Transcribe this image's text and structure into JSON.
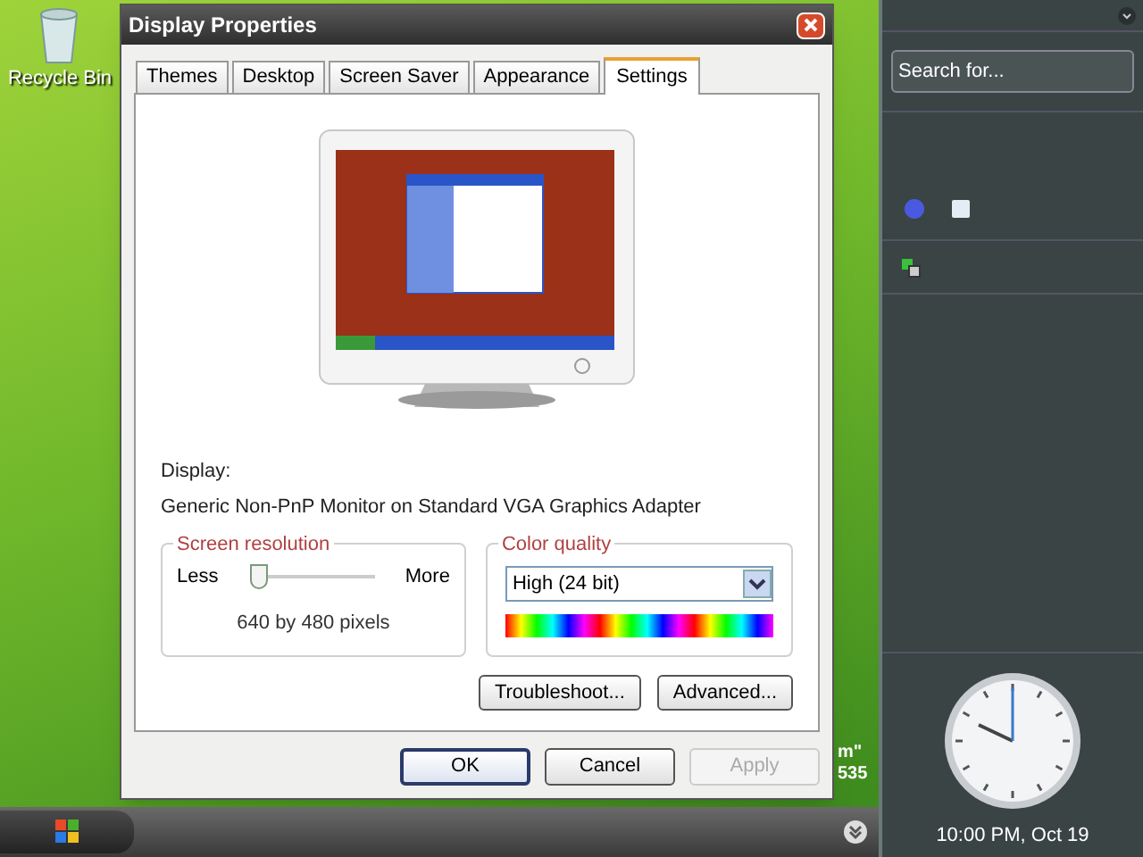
{
  "desktop": {
    "icons": [
      {
        "label": "Recycle Bin"
      }
    ],
    "fragments": [
      "m\"",
      "535"
    ]
  },
  "window": {
    "title": "Display Properties"
  },
  "tabs": [
    {
      "label": "Themes",
      "selected": false
    },
    {
      "label": "Desktop",
      "selected": false
    },
    {
      "label": "Screen Saver",
      "selected": false
    },
    {
      "label": "Appearance",
      "selected": false
    },
    {
      "label": "Settings",
      "selected": true
    }
  ],
  "display": {
    "label": "Display:",
    "adapter": "Generic Non-PnP Monitor on Standard VGA Graphics Adapter"
  },
  "resolution": {
    "title": "Screen resolution",
    "less": "Less",
    "more": "More",
    "level": 0,
    "reading": "640 by 480 pixels"
  },
  "color_quality": {
    "title": "Color quality",
    "value": "High (24 bit)"
  },
  "panel_buttons": [
    {
      "label": "Troubleshoot..."
    },
    {
      "label": "Advanced..."
    }
  ],
  "dialog_buttons": [
    {
      "label": "OK",
      "disabled": false,
      "default": true
    },
    {
      "label": "Cancel",
      "disabled": false,
      "default": false
    },
    {
      "label": "Apply",
      "disabled": true,
      "default": false
    }
  ],
  "sidebar": {
    "search": {
      "placeholder": "Search for..."
    },
    "clock": {
      "caption": "10:00 PM, Oct 19"
    }
  }
}
